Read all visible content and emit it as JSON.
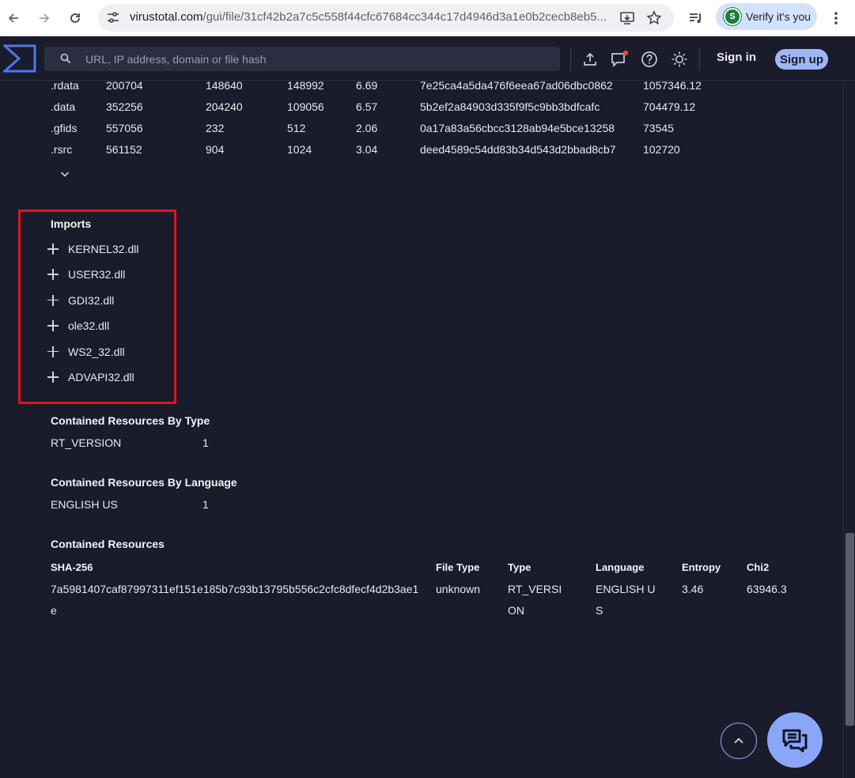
{
  "browser": {
    "url_host": "virustotal.com",
    "url_path": "/gui/file/31cf42b2a7c5c558f44cfc67684cc344c17d4946d3a1e0b2cecb8eb5...",
    "verify_label": "Verify it's you",
    "profile_initial": "S"
  },
  "header": {
    "search_placeholder": "URL, IP address, domain or file hash",
    "signin_label": "Sign in",
    "signup_label": "Sign up"
  },
  "sections_table": {
    "rows": [
      [
        ".rdata",
        "200704",
        "148640",
        "148992",
        "6.69",
        "7e25ca4a5da476f6eea67ad06dbc0862",
        "1057346.12"
      ],
      [
        ".data",
        "352256",
        "204240",
        "109056",
        "6.57",
        "5b2ef2a84903d335f9f5c9bb3bdfcafc",
        "704479.12"
      ],
      [
        ".gfids",
        "557056",
        "232",
        "512",
        "2.06",
        "0a17a83a56cbcc3128ab94e5bce13258",
        "73545"
      ],
      [
        ".rsrc",
        "561152",
        "904",
        "1024",
        "3.04",
        "deed4589c54dd83b34d543d2bbad8cb7",
        "102720"
      ]
    ]
  },
  "imports": {
    "title": "Imports",
    "items": [
      "KERNEL32.dll",
      "USER32.dll",
      "GDI32.dll",
      "ole32.dll",
      "WS2_32.dll",
      "ADVAPI32.dll"
    ]
  },
  "resources_by_type": {
    "title": "Contained Resources By Type",
    "label": "RT_VERSION",
    "count": "1"
  },
  "resources_by_language": {
    "title": "Contained Resources By Language",
    "label": "ENGLISH US",
    "count": "1"
  },
  "contained_resources": {
    "title": "Contained Resources",
    "headers": [
      "SHA-256",
      "File Type",
      "Type",
      "Language",
      "Entropy",
      "Chi2"
    ],
    "row": [
      "7a5981407caf87997311ef151e185b7c93b13795b556c2cfc8dfecf4d2b3ae1e",
      "unknown",
      "RT_VERSION",
      "ENGLISH US",
      "3.46",
      "63946.3"
    ]
  },
  "colors": {
    "background": "#1a1b2b",
    "accent": "#8aa6f7",
    "highlight_box": "#e0141e"
  }
}
